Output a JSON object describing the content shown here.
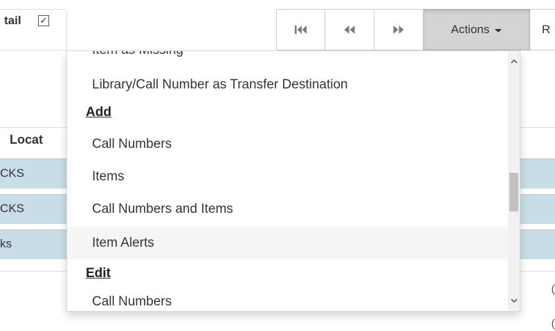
{
  "toolbar": {
    "detail_label": "tail",
    "detail_checked": "✓",
    "actions_label": "Actions",
    "next_label": "R",
    "nav_icons": [
      "first-page-icon",
      "previous-page-icon",
      "next-page-icon"
    ]
  },
  "grid": {
    "location_header": "Locat",
    "rows": [
      {
        "location": "CKS"
      },
      {
        "location": "CKS"
      },
      {
        "location": "ks"
      }
    ],
    "right_edge_glyphs": [
      "(",
      "("
    ]
  },
  "menu": {
    "clipped_item": "Item as Missing",
    "items_top": [
      {
        "label": "Library/Call Number as Transfer Destination"
      }
    ],
    "add_header": "Add",
    "add_items": [
      {
        "label": "Call Numbers"
      },
      {
        "label": "Items"
      },
      {
        "label": "Call Numbers and Items"
      },
      {
        "label": "Item Alerts"
      }
    ],
    "edit_header": "Edit",
    "edit_items": [
      {
        "label": "Call Numbers"
      }
    ],
    "hovered_item": "Item Alerts"
  },
  "colors": {
    "row_background": "#c8dde7",
    "actions_active": "#d4d4d4",
    "menu_hover": "#f5f5f5"
  }
}
